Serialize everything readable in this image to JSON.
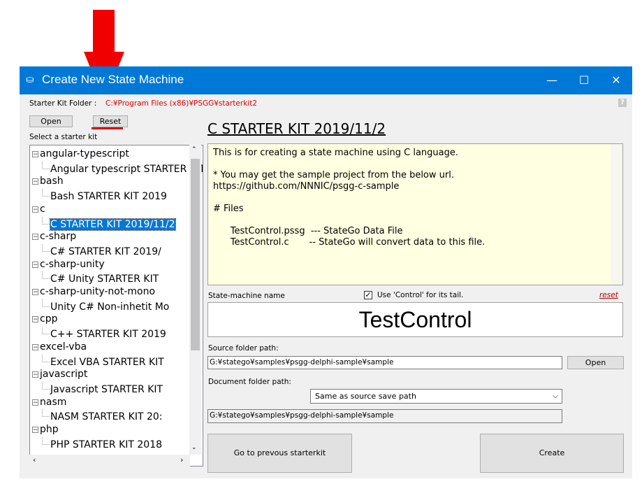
{
  "window": {
    "title": "Create New State Machine",
    "minimize_glyph": "—",
    "maximize_glyph": "☐",
    "close_glyph": "✕"
  },
  "starter_kit": {
    "folder_label": "Starter Kit Folder :",
    "folder_path": "C:¥Program Files (x86)¥PSGG¥starterkit2",
    "open_button": "Open",
    "reset_button": "Reset",
    "select_label": "Select a starter kit",
    "help": "?"
  },
  "tree": {
    "items": [
      {
        "label": "angular-typescript",
        "level": 0
      },
      {
        "label": "Angular typescript STARTER KIT",
        "level": 1
      },
      {
        "label": "bash",
        "level": 0
      },
      {
        "label": "Bash STARTER KIT 2019",
        "level": 1
      },
      {
        "label": "c",
        "level": 0
      },
      {
        "label": "C STARTER KIT 2019/11/2",
        "level": 1,
        "selected": true
      },
      {
        "label": "c-sharp",
        "level": 0
      },
      {
        "label": "C# STARTER KIT 2019/",
        "level": 1
      },
      {
        "label": "c-sharp-unity",
        "level": 0
      },
      {
        "label": "C# Unity STARTER KIT",
        "level": 1
      },
      {
        "label": "c-sharp-unity-not-mono",
        "level": 0
      },
      {
        "label": "Unity C# Non-inhetit Mo",
        "level": 1
      },
      {
        "label": "cpp",
        "level": 0
      },
      {
        "label": "C++ STARTER KIT 2019",
        "level": 1
      },
      {
        "label": "excel-vba",
        "level": 0
      },
      {
        "label": "Excel VBA STARTER KIT",
        "level": 1
      },
      {
        "label": "javascript",
        "level": 0
      },
      {
        "label": "Javascript STARTER KIT",
        "level": 1
      },
      {
        "label": "nasm",
        "level": 0
      },
      {
        "label": "NASM STARTER KIT 20:",
        "level": 1
      },
      {
        "label": "php",
        "level": 0
      },
      {
        "label": "PHP STARTER KIT 2018",
        "level": 1
      }
    ]
  },
  "kit": {
    "title": "C STARTER KIT 2019/11/2",
    "description": "This is for creating a state machine using C language.\n\n* You may get the sample project from the below url.\nhttps://github.com/NNNIC/psgg-c-sample\n\n# Files\n\n      TestControl.pssg  --- StateGo Data File\n      TestControl.c       -- StateGo will convert data to this file."
  },
  "state_machine": {
    "name_label": "State-machine name",
    "use_control_label": "Use 'Control' for its tail.",
    "use_control_checked": true,
    "reset_link": "reset",
    "name_value": "TestControl"
  },
  "paths": {
    "source_label": "Source folder path:",
    "source_value": "G:¥statego¥samples¥psgg-delphi-sample¥sample",
    "source_open": "Open",
    "document_label": "Document folder path:",
    "document_mode": "Same as source save path",
    "document_value": "G:¥statego¥samples¥psgg-delphi-sample¥sample"
  },
  "actions": {
    "previous": "Go to prevous starterkit",
    "create": "Create"
  }
}
